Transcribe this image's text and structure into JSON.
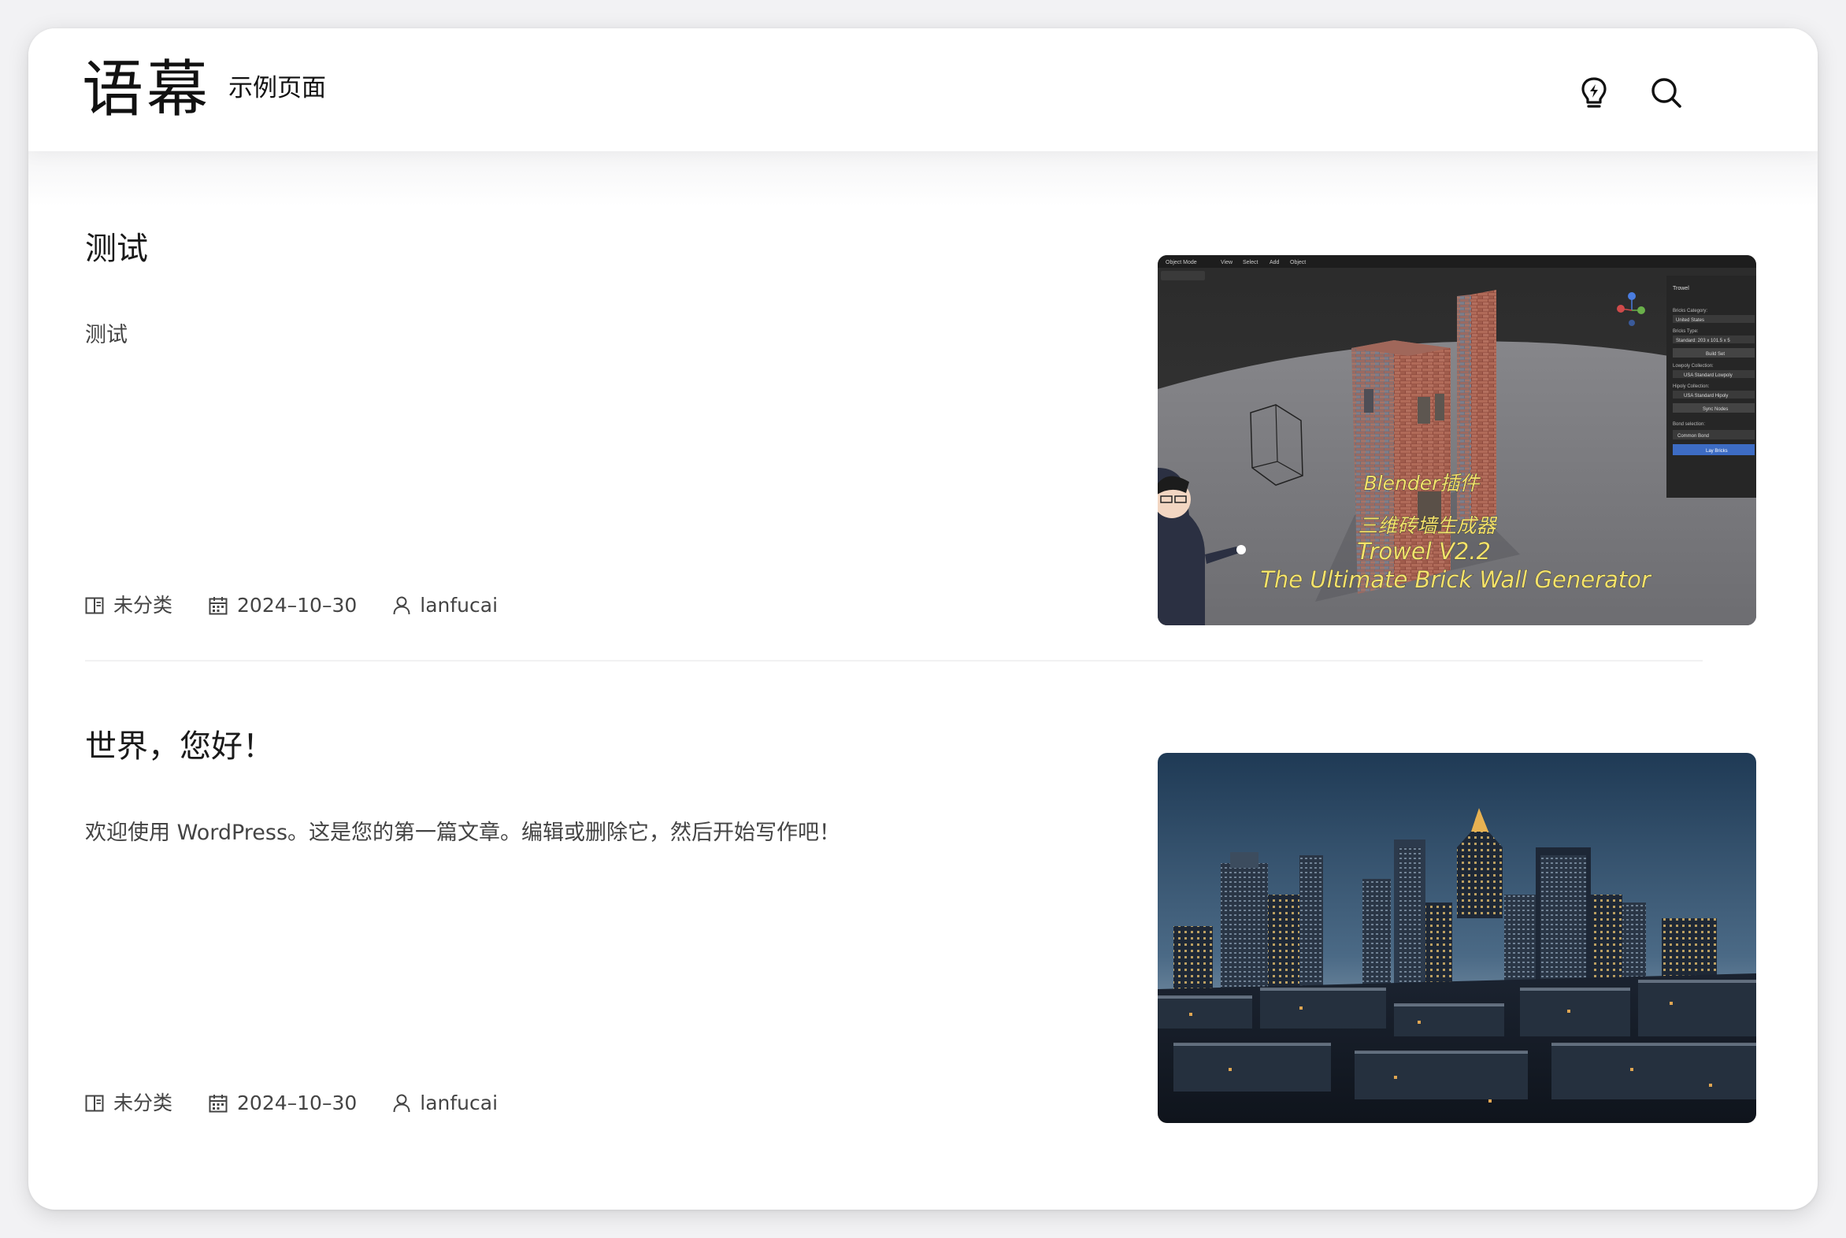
{
  "site": {
    "logo": "语幕",
    "nav_link": "示例页面"
  },
  "header": {
    "bulb_icon": "bulb-icon",
    "search_icon": "search-icon"
  },
  "posts": [
    {
      "title": "测试",
      "excerpt": "测试",
      "category": "未分类",
      "date": "2024–10–30",
      "author": "lanfucai",
      "thumbnail": {
        "description": "Blender addon screenshot with brick chimney",
        "caption_1": "Blender插件",
        "caption_2": "三维砖墙生成器",
        "caption_3": "Trowel V2.2",
        "caption_4": "The Ultimate Brick Wall Generator",
        "menu": [
          "Object Mode",
          "View",
          "Select",
          "Add",
          "Object"
        ],
        "panel_title": "Trowel",
        "panel_items": [
          "Bricks Category:",
          "United States",
          "Bricks Type:",
          "Standard: 203 x 101.5 x 5",
          "Build Set",
          "Lowpoly Collection:",
          "USA Standard Lowpoly",
          "Hipoly Collection:",
          "USA Standard Hipoly",
          "Sync Nodes",
          "Bond selection:",
          "Common Bond",
          "Lay Bricks"
        ]
      }
    },
    {
      "title": "世界，您好！",
      "excerpt": "欢迎使用 WordPress。这是您的第一篇文章。编辑或删除它，然后开始写作吧！",
      "category": "未分类",
      "date": "2024–10–30",
      "author": "lanfucai",
      "thumbnail": {
        "description": "City skyline at dusk"
      }
    }
  ],
  "colors": {
    "background": "#f2f2f4",
    "card": "#ffffff",
    "text": "#1a1a1a",
    "muted": "#444444",
    "panel_blue": "#3d6cc4"
  }
}
